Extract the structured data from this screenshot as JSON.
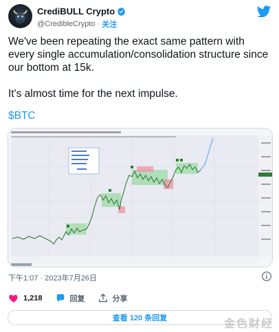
{
  "author": {
    "display_name": "CrediBULL Crypto",
    "handle": "@CredibleCrypto",
    "follow_label": "关注"
  },
  "tweet": {
    "line1": "We've been repeating the exact same pattern with every single accumulation/consolidation structure since our bottom at 15k.",
    "line2": "It's almost time for the next impulse.",
    "cashtag": "$BTC",
    "timestamp": "下午1:07 · 2023年7月26日"
  },
  "chart_image": {
    "legend": [
      "1. impulse",
      "2. form range",
      "3. take highs",
      "4. take lows",
      "repeat"
    ],
    "accent_colors": {
      "range": "#7fd38a",
      "highs": "#f08ca0",
      "price": "#2e7d32",
      "projection": "#64b5f6"
    }
  },
  "actions": {
    "like_count": "1,218",
    "reply_label": "回复",
    "share_label": "分享"
  },
  "replies_button_label": "查看 120 条回复",
  "watermark": "金色财经",
  "colors": {
    "link": "#1d9bf0",
    "like": "#f91880",
    "muted": "#536471"
  }
}
